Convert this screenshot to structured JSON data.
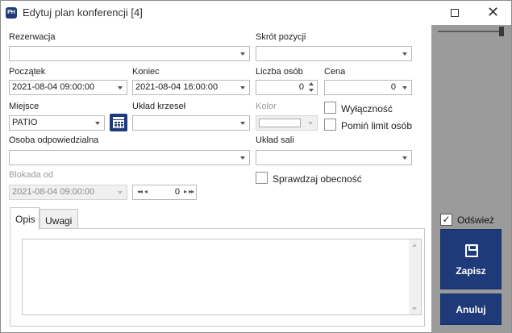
{
  "window": {
    "title": "Edytuj plan konferencji [4]",
    "app_icon_text": "PH",
    "icons": {
      "minimize": "maximize-icon",
      "close": "close-icon"
    }
  },
  "form": {
    "rezerwacja": {
      "label": "Rezerwacja",
      "value": ""
    },
    "skrot_pozycji": {
      "label": "Skrót pozycji",
      "value": ""
    },
    "poczatek": {
      "label": "Początek",
      "value": "2021-08-04 09:00:00"
    },
    "koniec": {
      "label": "Koniec",
      "value": "2021-08-04 16:00:00"
    },
    "liczba_osob": {
      "label": "Liczba osób",
      "value": "0"
    },
    "cena": {
      "label": "Cena",
      "value": "0"
    },
    "miejsce": {
      "label": "Miejsce",
      "value": "PATIO"
    },
    "uklad_krzesel": {
      "label": "Układ krzeseł",
      "value": ""
    },
    "kolor": {
      "label": "Kolor"
    },
    "wylacznosc": {
      "label": "Wyłączność",
      "checked": false
    },
    "pomin_limit": {
      "label": "Pomiń limit osób",
      "checked": false
    },
    "osoba_odpowiedzialna": {
      "label": "Osoba odpowiedzialna",
      "value": ""
    },
    "uklad_sali": {
      "label": "Układ sali",
      "value": ""
    },
    "blokada_od": {
      "label": "Blokada od",
      "value": "2021-08-04 09:00:00",
      "spin_value": "0"
    },
    "sprawdzaj_obecnosc": {
      "label": "Sprawdzaj obecność",
      "checked": false
    }
  },
  "tabs": [
    {
      "label": "Opis",
      "active": true
    },
    {
      "label": "Uwagi",
      "active": false
    }
  ],
  "sidebar": {
    "odswiez": {
      "label": "Odśwież",
      "checked": true,
      "mark": "✓"
    },
    "save_label": "Zapisz",
    "cancel_label": "Anuluj"
  },
  "colors": {
    "accent": "#1e3a78",
    "sidebar_bg": "#9b9b9b"
  }
}
